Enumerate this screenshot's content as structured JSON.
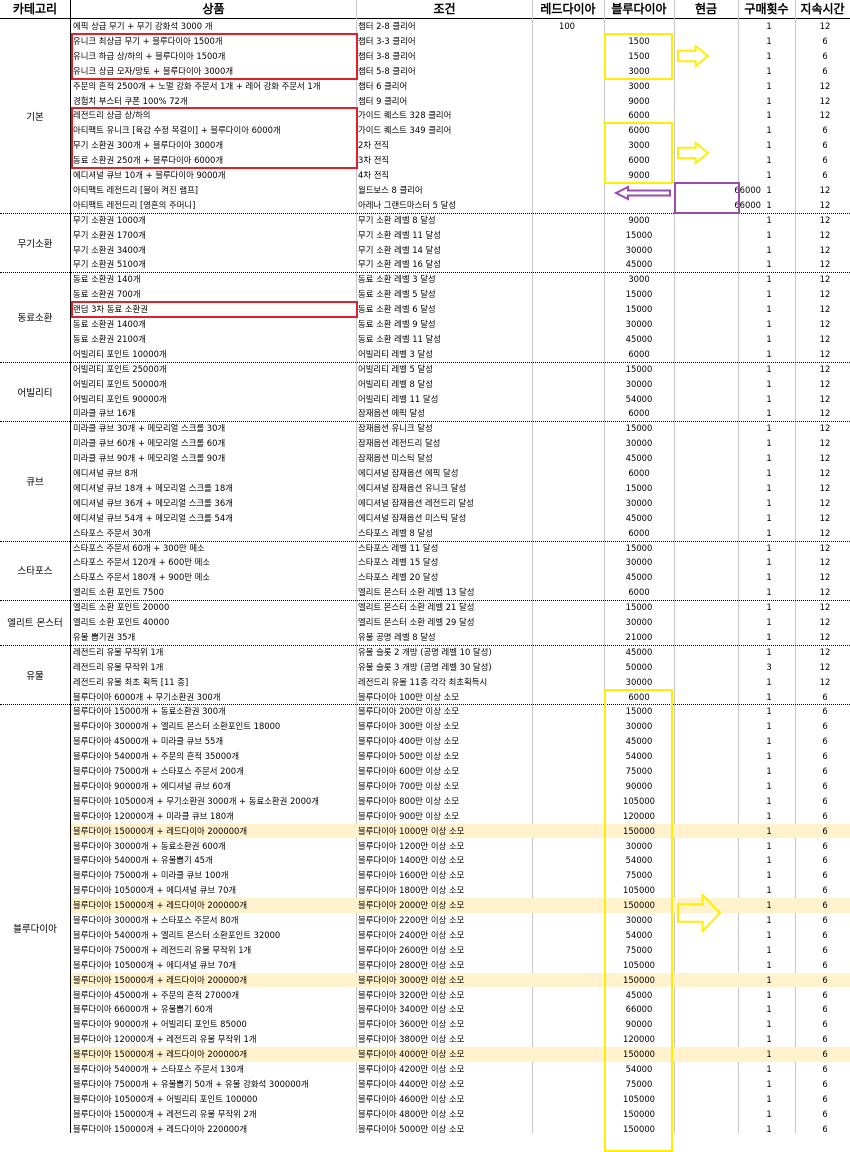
{
  "headers": {
    "category": "카테고리",
    "product": "상품",
    "condition": "조건",
    "red_dia": "레드다이아",
    "blue_dia": "블루다이아",
    "cash": "현금",
    "buy_count": "구매횟수",
    "duration": "지속시간"
  },
  "categories": [
    {
      "label": "기본",
      "start": 0,
      "count": 13
    },
    {
      "label": "무기소환",
      "start": 13,
      "count": 4
    },
    {
      "label": "동료소환",
      "start": 17,
      "count": 6
    },
    {
      "label": "어빌리티",
      "start": 23,
      "count": 4
    },
    {
      "label": "큐브",
      "start": 27,
      "count": 8
    },
    {
      "label": "스타포스",
      "start": 35,
      "count": 4
    },
    {
      "label": "엘리트 몬스터",
      "start": 39,
      "count": 3
    },
    {
      "label": "유물",
      "start": 42,
      "count": 4
    },
    {
      "label": "블루다이아",
      "start": 46,
      "count": 30
    }
  ],
  "rows": [
    {
      "product": "에픽 상급 무기 + 무기 강화석 3000 개",
      "condition": "챕터 2-8 클리어",
      "red": "100",
      "blue": "",
      "cash": "",
      "count": "1",
      "dur": "12"
    },
    {
      "product": "유니크 최상급 무기 + 블루다이아 1500개",
      "condition": "챕터 3-3 클리어",
      "red": "",
      "blue": "1500",
      "cash": "",
      "count": "1",
      "dur": "6"
    },
    {
      "product": "유니크 하급 상/하의 + 블루다이아 1500개",
      "condition": "챕터 3-8 클리어",
      "red": "",
      "blue": "1500",
      "cash": "",
      "count": "1",
      "dur": "6"
    },
    {
      "product": "유니크 상급 모자/망토 + 블루다이아 3000개",
      "condition": "챕터 5-8 클리어",
      "red": "",
      "blue": "3000",
      "cash": "",
      "count": "1",
      "dur": "6"
    },
    {
      "product": "주문의 흔적 2500개 + 노멀 강화 주문서 1개 + 레어 강화 주문서 1개",
      "condition": "챕터 6 클리어",
      "red": "",
      "blue": "3000",
      "cash": "",
      "count": "1",
      "dur": "12"
    },
    {
      "product": "경험치 부스터 쿠폰 100% 72개",
      "condition": "챕터 9 클리어",
      "red": "",
      "blue": "9000",
      "cash": "",
      "count": "1",
      "dur": "12"
    },
    {
      "product": "레전드리 상급 상/하의",
      "condition": "가이드 퀘스트 328 클리어",
      "red": "",
      "blue": "6000",
      "cash": "",
      "count": "1",
      "dur": "12"
    },
    {
      "product": "아티팩트 유니크 [육감 수정 목걸이] + 블루다이아 6000개",
      "condition": "가이드 퀘스트 349 클리어",
      "red": "",
      "blue": "6000",
      "cash": "",
      "count": "1",
      "dur": "6"
    },
    {
      "product": "무기 소환권 300개 + 블루다이아 3000개",
      "condition": "2차 전직",
      "red": "",
      "blue": "3000",
      "cash": "",
      "count": "1",
      "dur": "6"
    },
    {
      "product": "동료 소환권 250개 + 블루다이아 6000개",
      "condition": "3차 전직",
      "red": "",
      "blue": "6000",
      "cash": "",
      "count": "1",
      "dur": "6"
    },
    {
      "product": "에디셔널 큐브 10개 + 블루다이아 9000개",
      "condition": "4차 전직",
      "red": "",
      "blue": "9000",
      "cash": "",
      "count": "1",
      "dur": "6"
    },
    {
      "product": "아티팩트 레전드리 [불이 켜진 램프]",
      "condition": "월드보스 8 클리어",
      "red": "",
      "blue": "",
      "cash": "66000",
      "count": "1",
      "dur": "12"
    },
    {
      "product": "아티팩트 레전드리 [영혼의 주머니]",
      "condition": "아레나 그랜드마스터 5 달성",
      "red": "",
      "blue": "",
      "cash": "66000",
      "count": "1",
      "dur": "12"
    },
    {
      "product": "무기 소환권 1000개",
      "condition": "무기 소환 레벨 8 달성",
      "red": "",
      "blue": "9000",
      "cash": "",
      "count": "1",
      "dur": "12"
    },
    {
      "product": "무기 소환권 1700개",
      "condition": "무기 소환 레벨 11 달성",
      "red": "",
      "blue": "15000",
      "cash": "",
      "count": "1",
      "dur": "12"
    },
    {
      "product": "무기 소환권 3400개",
      "condition": "무기 소환 레벨 14 달성",
      "red": "",
      "blue": "30000",
      "cash": "",
      "count": "1",
      "dur": "12"
    },
    {
      "product": "무기 소환권 5100개",
      "condition": "무기 소환 레벨 16 달성",
      "red": "",
      "blue": "45000",
      "cash": "",
      "count": "1",
      "dur": "12"
    },
    {
      "product": "동료 소환권 140개",
      "condition": "동료 소환 레벨 3 달성",
      "red": "",
      "blue": "3000",
      "cash": "",
      "count": "1",
      "dur": "12"
    },
    {
      "product": "동료 소환권 700개",
      "condition": "동료 소환 레벨 5 달성",
      "red": "",
      "blue": "15000",
      "cash": "",
      "count": "1",
      "dur": "12"
    },
    {
      "product": "랜덤 3차 동료 소환권",
      "condition": "동료 소환 레벨 6 달성",
      "red": "",
      "blue": "15000",
      "cash": "",
      "count": "1",
      "dur": "12"
    },
    {
      "product": "동료 소환권 1400개",
      "condition": "동료 소환 레벨 9 달성",
      "red": "",
      "blue": "30000",
      "cash": "",
      "count": "1",
      "dur": "12"
    },
    {
      "product": "동료 소환권 2100개",
      "condition": "동료 소환 레벨 11 달성",
      "red": "",
      "blue": "45000",
      "cash": "",
      "count": "1",
      "dur": "12"
    },
    {
      "product": "어빌리티 포인트 10000개",
      "condition": "어빌리티 레벨 3 달성",
      "red": "",
      "blue": "6000",
      "cash": "",
      "count": "1",
      "dur": "12"
    },
    {
      "product": "어빌리티 포인트 25000개",
      "condition": "어빌리티 레벨 5 달성",
      "red": "",
      "blue": "15000",
      "cash": "",
      "count": "1",
      "dur": "12"
    },
    {
      "product": "어빌리티 포인트 50000개",
      "condition": "어빌리티 레벨 8 달성",
      "red": "",
      "blue": "30000",
      "cash": "",
      "count": "1",
      "dur": "12"
    },
    {
      "product": "어빌리티 포인트 90000개",
      "condition": "어빌리티 레벨 11 달성",
      "red": "",
      "blue": "54000",
      "cash": "",
      "count": "1",
      "dur": "12"
    },
    {
      "product": "미라클 큐브 16개",
      "condition": "잠재옵션 에픽 달성",
      "red": "",
      "blue": "6000",
      "cash": "",
      "count": "1",
      "dur": "12"
    },
    {
      "product": "미라클 큐브 30개 + 메모리얼 스크롤 30개",
      "condition": "잠재옵션 유니크 달성",
      "red": "",
      "blue": "15000",
      "cash": "",
      "count": "1",
      "dur": "12"
    },
    {
      "product": "미라클 큐브 60개 + 메모리얼 스크롤 60개",
      "condition": "잠재옵션 레전드리 달성",
      "red": "",
      "blue": "30000",
      "cash": "",
      "count": "1",
      "dur": "12"
    },
    {
      "product": "미라클 큐브 90개 + 메모리얼 스크롤 90개",
      "condition": "잠재옵션 미스틱 달성",
      "red": "",
      "blue": "45000",
      "cash": "",
      "count": "1",
      "dur": "12"
    },
    {
      "product": "에디셔널 큐브 8개",
      "condition": "에디셔널 잠재옵션 에픽 달성",
      "red": "",
      "blue": "6000",
      "cash": "",
      "count": "1",
      "dur": "12"
    },
    {
      "product": "에디셔널 큐브 18개 + 메모리얼 스크롤 18개",
      "condition": "에디셔널 잠재옵션 유니크 달성",
      "red": "",
      "blue": "15000",
      "cash": "",
      "count": "1",
      "dur": "12"
    },
    {
      "product": "에디셔널 큐브 36개 + 메모리얼 스크롤 36개",
      "condition": "에디셔널 잠재옵션 레전드리 달성",
      "red": "",
      "blue": "30000",
      "cash": "",
      "count": "1",
      "dur": "12"
    },
    {
      "product": "에디셔널 큐브 54개 + 메모리얼 스크롤 54개",
      "condition": "에디셔널 잠재옵션 미스틱 달성",
      "red": "",
      "blue": "45000",
      "cash": "",
      "count": "1",
      "dur": "12"
    },
    {
      "product": "스타포스 주문서 30개",
      "condition": "스타포스 레벨 8 달성",
      "red": "",
      "blue": "6000",
      "cash": "",
      "count": "1",
      "dur": "12"
    },
    {
      "product": "스타포스 주문서 60개 + 300만 메소",
      "condition": "스타포스 레벨 11 달성",
      "red": "",
      "blue": "15000",
      "cash": "",
      "count": "1",
      "dur": "12"
    },
    {
      "product": "스타포스 주문서 120개 + 600만 메소",
      "condition": "스타포스 레벨 15 달성",
      "red": "",
      "blue": "30000",
      "cash": "",
      "count": "1",
      "dur": "12"
    },
    {
      "product": "스타포스 주문서 180개 + 900만 메소",
      "condition": "스타포스 레벨 20 달성",
      "red": "",
      "blue": "45000",
      "cash": "",
      "count": "1",
      "dur": "12"
    },
    {
      "product": "엘리트 소환 포인트 7500",
      "condition": "엘리트 몬스터 소환 레벨 13 달성",
      "red": "",
      "blue": "6000",
      "cash": "",
      "count": "1",
      "dur": "12"
    },
    {
      "product": "엘리트 소환 포인트 20000",
      "condition": "엘리트 몬스터 소환 레벨 21 달성",
      "red": "",
      "blue": "15000",
      "cash": "",
      "count": "1",
      "dur": "12"
    },
    {
      "product": "엘리트 소환 포인트 40000",
      "condition": "엘리트 몬스터 소환 레벨 29 달성",
      "red": "",
      "blue": "30000",
      "cash": "",
      "count": "1",
      "dur": "12"
    },
    {
      "product": "유물 뽑기권 35개",
      "condition": "유물 공명 레벨 8 달성",
      "red": "",
      "blue": "21000",
      "cash": "",
      "count": "1",
      "dur": "12"
    },
    {
      "product": "레전드리 유물 무작위 1개",
      "condition": "유물 슬롯 2 개방 (공명 레벨 10 달성)",
      "red": "",
      "blue": "45000",
      "cash": "",
      "count": "1",
      "dur": "12"
    },
    {
      "product": "레전드리 유물 무작위 1개",
      "condition": "유물 슬롯 3 개방 (공명 레벨 30 달성)",
      "red": "",
      "blue": "50000",
      "cash": "",
      "count": "3",
      "dur": "12"
    },
    {
      "product": "레전드리 유물 최초 획득 [11 종]",
      "condition": "레전드리 유물 11종 각각 최초획득시",
      "red": "",
      "blue": "30000",
      "cash": "",
      "count": "1",
      "dur": "12"
    },
    {
      "product": "블루다이아 6000개 + 무기소환권 300개",
      "condition": "블루다이아 100만 이상 소모",
      "red": "",
      "blue": "6000",
      "cash": "",
      "count": "1",
      "dur": "6"
    },
    {
      "product": "블루다이아 15000개 + 동료소환권 300개",
      "condition": "블루다이아 200만 이상 소모",
      "red": "",
      "blue": "15000",
      "cash": "",
      "count": "1",
      "dur": "6"
    },
    {
      "product": "블루다이아 30000개 + 엘리트 몬스터 소환포인트 18000",
      "condition": "블루다이아 300만 이상 소모",
      "red": "",
      "blue": "30000",
      "cash": "",
      "count": "1",
      "dur": "6"
    },
    {
      "product": "블루다이아 45000개 + 미라클 큐브 55개",
      "condition": "블루다이아 400만 이상 소모",
      "red": "",
      "blue": "45000",
      "cash": "",
      "count": "1",
      "dur": "6"
    },
    {
      "product": "블루다이아 54000개 + 주문의 흔적 35000개",
      "condition": "블루다이아 500만 이상 소모",
      "red": "",
      "blue": "54000",
      "cash": "",
      "count": "1",
      "dur": "6"
    },
    {
      "product": "블루다이아 75000개 + 스타포스 주문서 200개",
      "condition": "블루다이아 600만 이상 소모",
      "red": "",
      "blue": "75000",
      "cash": "",
      "count": "1",
      "dur": "6"
    },
    {
      "product": "블루다이아 90000개 + 에디셔널 큐브 60개",
      "condition": "블루다이아 700만 이상 소모",
      "red": "",
      "blue": "90000",
      "cash": "",
      "count": "1",
      "dur": "6"
    },
    {
      "product": "블루다이아 105000개 + 무기소환권 3000개 + 동료소환권 2000개",
      "condition": "블루다이아 800만 이상 소모",
      "red": "",
      "blue": "105000",
      "cash": "",
      "count": "1",
      "dur": "6"
    },
    {
      "product": "블루다이아 120000개 + 미라클 큐브 180개",
      "condition": "블루다이아 900만 이상 소모",
      "red": "",
      "blue": "120000",
      "cash": "",
      "count": "1",
      "dur": "6"
    },
    {
      "product": "블루다이아 150000개 + 레드다이아 200000개",
      "condition": "블루다이아 1000만 이상 소모",
      "red": "",
      "blue": "150000",
      "cash": "",
      "count": "1",
      "dur": "6",
      "hl": true
    },
    {
      "product": "블루다이아 30000개 + 동료소환권 600개",
      "condition": "블루다이아 1200만 이상 소모",
      "red": "",
      "blue": "30000",
      "cash": "",
      "count": "1",
      "dur": "6"
    },
    {
      "product": "블루다이아 54000개 + 유물뽑기 45개",
      "condition": "블루다이아 1400만 이상 소모",
      "red": "",
      "blue": "54000",
      "cash": "",
      "count": "1",
      "dur": "6"
    },
    {
      "product": "블루다이아 75000개 + 미라클 큐브 100개",
      "condition": "블루다이아 1600만 이상 소모",
      "red": "",
      "blue": "75000",
      "cash": "",
      "count": "1",
      "dur": "6"
    },
    {
      "product": "블루다이아 105000개 + 에디셔널 큐브 70개",
      "condition": "블루다이아 1800만 이상 소모",
      "red": "",
      "blue": "105000",
      "cash": "",
      "count": "1",
      "dur": "6"
    },
    {
      "product": "블루다이아 150000개 + 레드다이아 200000개",
      "condition": "블루다이아 2000만 이상 소모",
      "red": "",
      "blue": "150000",
      "cash": "",
      "count": "1",
      "dur": "6",
      "hl": true
    },
    {
      "product": "블루다이아 30000개 + 스타포스 주문서 80개",
      "condition": "블루다이아 2200만 이상 소모",
      "red": "",
      "blue": "30000",
      "cash": "",
      "count": "1",
      "dur": "6"
    },
    {
      "product": "블루다이아 54000개 + 엘리트 몬스터 소환포인트 32000",
      "condition": "블루다이아 2400만 이상 소모",
      "red": "",
      "blue": "54000",
      "cash": "",
      "count": "1",
      "dur": "6"
    },
    {
      "product": "블루다이아 75000개 + 레전드리 유물 무작위 1개",
      "condition": "블루다이아 2600만 이상 소모",
      "red": "",
      "blue": "75000",
      "cash": "",
      "count": "1",
      "dur": "6"
    },
    {
      "product": "블루다이아 105000개 + 에디셔널 큐브 70개",
      "condition": "블루다이아 2800만 이상 소모",
      "red": "",
      "blue": "105000",
      "cash": "",
      "count": "1",
      "dur": "6"
    },
    {
      "product": "블루다이아 150000개 + 레드다이아 200000개",
      "condition": "블루다이아 3000만 이상 소모",
      "red": "",
      "blue": "150000",
      "cash": "",
      "count": "1",
      "dur": "6",
      "hl": true
    },
    {
      "product": "블루다이아 45000개 + 주문의 흔적 27000개",
      "condition": "블루다이아 3200만 이상 소모",
      "red": "",
      "blue": "45000",
      "cash": "",
      "count": "1",
      "dur": "6"
    },
    {
      "product": "블루다이아 66000개 + 유물뽑기 60개",
      "condition": "블루다이아 3400만 이상 소모",
      "red": "",
      "blue": "66000",
      "cash": "",
      "count": "1",
      "dur": "6"
    },
    {
      "product": "블루다이아 90000개 + 어빌리티 포인트 85000",
      "condition": "블루다이아 3600만 이상 소모",
      "red": "",
      "blue": "90000",
      "cash": "",
      "count": "1",
      "dur": "6"
    },
    {
      "product": "블루다이아 120000개 + 레전드리 유물 무작위 1개",
      "condition": "블루다이아 3800만 이상 소모",
      "red": "",
      "blue": "120000",
      "cash": "",
      "count": "1",
      "dur": "6"
    },
    {
      "product": "블루다이아 150000개 + 레드다이아 200000개",
      "condition": "블루다이아 4000만 이상 소모",
      "red": "",
      "blue": "150000",
      "cash": "",
      "count": "1",
      "dur": "6",
      "hl": true
    },
    {
      "product": "블루다이아 54000개 + 스타포스 주문서 130개",
      "condition": "블루다이아 4200만 이상 소모",
      "red": "",
      "blue": "54000",
      "cash": "",
      "count": "1",
      "dur": "6"
    },
    {
      "product": "블루다이아 75000개 + 유물뽑기 50개 + 유물 강화석 300000개",
      "condition": "블루다이아 4400만 이상 소모",
      "red": "",
      "blue": "75000",
      "cash": "",
      "count": "1",
      "dur": "6"
    },
    {
      "product": "블루다이아 105000개 + 어빌리티 포인트 100000",
      "condition": "블루다이아 4600만 이상 소모",
      "red": "",
      "blue": "105000",
      "cash": "",
      "count": "1",
      "dur": "6"
    },
    {
      "product": "블루다이아 150000개 + 레전드리 유물 무작위 2개",
      "condition": "블루다이아 4800만 이상 소모",
      "red": "",
      "blue": "150000",
      "cash": "",
      "count": "1",
      "dur": "6"
    },
    {
      "product": "블루다이아 150000개 + 레드다이아 220000개",
      "condition": "블루다이아 5000만 이상 소모",
      "red": "",
      "blue": "150000",
      "cash": "",
      "count": "1",
      "dur": "6"
    }
  ],
  "annotations": {
    "colors": {
      "red": "#e0202a",
      "yellow": "#ffee00",
      "purple": "#9a4bb0",
      "highlight_row": "#fff2cc"
    },
    "red_boxes": [
      {
        "first_row": 1,
        "last_row": 3
      },
      {
        "first_row": 6,
        "last_row": 9
      },
      {
        "first_row": 19,
        "last_row": 19
      }
    ],
    "yellow_boxes": [
      {
        "first_row": 1,
        "last_row": 3
      },
      {
        "first_row": 7,
        "last_row": 10
      },
      {
        "first_row": 45,
        "last_row": 75
      }
    ],
    "purple_box": {
      "first_row": 11,
      "last_row": 12
    },
    "arrows": [
      {
        "icon": "right-arrow-icon",
        "color": "yellow",
        "row": 2
      },
      {
        "icon": "right-arrow-icon",
        "color": "yellow",
        "row": 8.5
      },
      {
        "icon": "left-arrow-icon",
        "color": "purple",
        "row": 11.2
      },
      {
        "icon": "right-arrow-icon",
        "color": "yellow",
        "row": 59.5
      }
    ]
  }
}
